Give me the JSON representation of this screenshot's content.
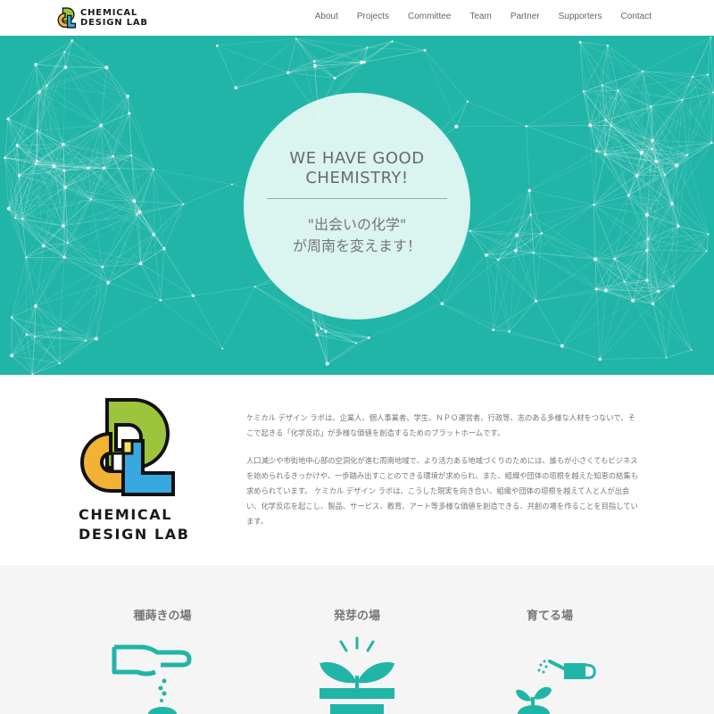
{
  "brand": {
    "line1": "CHEMICAL",
    "line2": "DESIGN LAB"
  },
  "nav": {
    "items": [
      "About",
      "Projects",
      "Committee",
      "Team",
      "Partner",
      "Supporters",
      "Contact"
    ]
  },
  "hero": {
    "title_line1": "WE HAVE GOOD",
    "title_line2": "CHEMISTRY!",
    "sub_line1": "\"出会いの化学\"",
    "sub_line2": "が周南を変えます！"
  },
  "about": {
    "paragraph1": "ケミカル デザイン ラボは、企業人、個人事業者、学生、ＮＰＯ運営者、行政等、志のある多様な人材をつないで、そこで起きる「化学反応」が多様な価値を創造するためのプラットホームです。",
    "paragraph2": "人口減少や市街地中心部の空洞化が進む周南地域で、より活力ある地域づくりのためには、誰もが小さくてもビジネスを始められるきっかけや、一歩踏み出すことのできる環境が求められ、また、組織や団体の垣根を越えた知恵の結集も求められています。 ケミカル デザイン ラボは、こうした現実を向き合い、組織や団体の垣根を越えて人と人が出会い、化学反応を起こし、製品、サービス、教育、アート等多様な価値を創造できる、共創の場を作ることを目指しています。"
  },
  "phases": {
    "seed": "種蒔きの場",
    "sprout": "発芽の場",
    "grow": "育てる場"
  },
  "colors": {
    "teal": "#21b5a8",
    "logo_yellow": "#f2b233",
    "logo_green": "#9cc43c",
    "logo_blue": "#38a8e0"
  }
}
